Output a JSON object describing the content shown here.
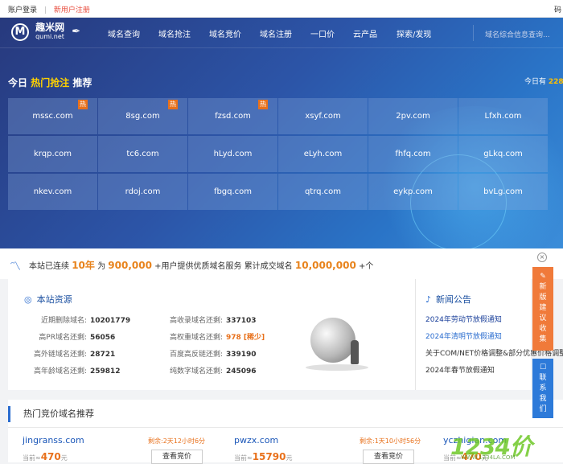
{
  "topbar": {
    "login": "账户登录",
    "sep": "|",
    "register": "新用户注册",
    "right_edge": "码"
  },
  "nav": {
    "logo_name": "趣米网",
    "logo_domain": "qumi.net",
    "items": [
      "域名查询",
      "域名抢注",
      "域名竞价",
      "域名注册",
      "一口价",
      "云产品",
      "探索/发现"
    ],
    "search_placeholder": "域名综合信息查询..."
  },
  "hot": {
    "prefix": "今日",
    "highlight": "热门抢注",
    "suffix": "推荐",
    "right_label": "今日有",
    "right_value": "228",
    "hot_badge": "热",
    "domains": [
      {
        "name": "mssc.com",
        "hot": true
      },
      {
        "name": "8sg.com",
        "hot": true
      },
      {
        "name": "fzsd.com",
        "hot": true
      },
      {
        "name": "xsyf.com",
        "hot": false
      },
      {
        "name": "2pv.com",
        "hot": false
      },
      {
        "name": "Lfxh.com",
        "hot": false
      },
      {
        "name": "krqp.com",
        "hot": false
      },
      {
        "name": "tc6.com",
        "hot": false
      },
      {
        "name": "hLyd.com",
        "hot": false
      },
      {
        "name": "eLyh.com",
        "hot": false
      },
      {
        "name": "fhfq.com",
        "hot": false
      },
      {
        "name": "gLkq.com",
        "hot": false
      },
      {
        "name": "nkev.com",
        "hot": false
      },
      {
        "name": "rdoj.com",
        "hot": false
      },
      {
        "name": "fbgq.com",
        "hot": false
      },
      {
        "name": "qtrq.com",
        "hot": false
      },
      {
        "name": "eykp.com",
        "hot": false
      },
      {
        "name": "bvLg.com",
        "hot": false
      }
    ]
  },
  "stats": {
    "t1": "本站已连续",
    "years": "10年",
    "t2": "为",
    "users": "900,000",
    "t3": "+用户提供优质域名服务",
    "t4": "累计成交域名",
    "deals": "10,000,000",
    "t5": "+个"
  },
  "resources": {
    "title": "本站资源",
    "rows": [
      {
        "label": "近期删除域名:",
        "value": "10201779",
        "orange": false
      },
      {
        "label": "高收录域名还剩:",
        "value": "337103",
        "orange": false
      },
      {
        "label": "高PR域名还剩:",
        "value": "56056",
        "orange": false
      },
      {
        "label": "高权重域名还剩:",
        "value": "978 [稀少]",
        "orange": true
      },
      {
        "label": "高外链域名还剩:",
        "value": "28721",
        "orange": false
      },
      {
        "label": "百度高反链还剩:",
        "value": "339190",
        "orange": false
      },
      {
        "label": "高年龄域名还剩:",
        "value": "259812",
        "orange": false
      },
      {
        "label": "纯数字域名还剩:",
        "value": "245096",
        "orange": false
      }
    ]
  },
  "notices": {
    "title": "新闻公告",
    "items": [
      {
        "text": "2024年劳动节放假通知",
        "color": "#1a3f9a"
      },
      {
        "text": "2024年清明节放假通知",
        "color": "#2a6ccf"
      },
      {
        "text": "关于COM/NET价格调整&部分优惠价格调整",
        "color": "#333333"
      },
      {
        "text": "2024年春节放假通知",
        "color": "#333333"
      }
    ]
  },
  "auction": {
    "title": "热门竞价域名推荐",
    "price_prefix": "当前≈",
    "price_unit": "元",
    "button": "查看竞价",
    "cards": [
      {
        "domain": "jingranss.com",
        "remain": "剩余:2天12小时6分",
        "price": "470"
      },
      {
        "domain": "pwzx.com",
        "remain": "剩余:1天10小时56分",
        "price": "15790"
      },
      {
        "domain": "yczhigian.com",
        "remain": "",
        "price": "470"
      }
    ]
  },
  "side": {
    "suggest": [
      "新",
      "版",
      "建",
      "议",
      "收",
      "集"
    ],
    "contact": [
      "联",
      "系",
      "我",
      "们"
    ],
    "close": "×"
  },
  "watermark": {
    "big": "1234价",
    "small": "WWW.1234LA.COM"
  },
  "colors": {
    "accent": "#2a6ccf",
    "orange": "#e8711c",
    "hero": "#2c55a8"
  }
}
